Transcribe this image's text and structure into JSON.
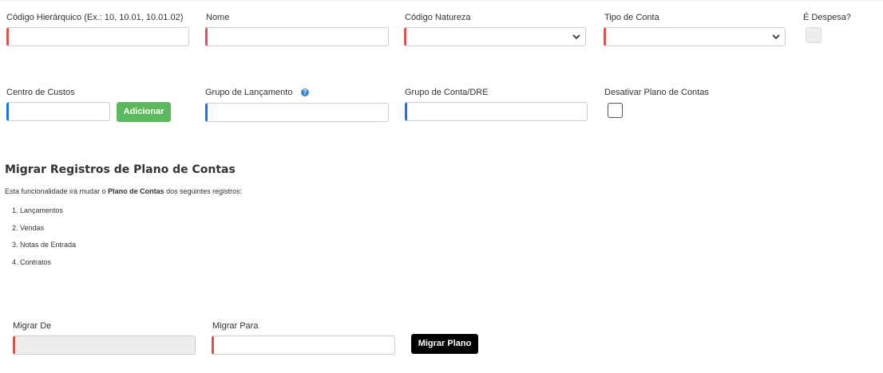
{
  "form": {
    "codigo_hierarquico": {
      "label": "Código Hierárquico (Ex.: 10, 10.01, 10.01.02)",
      "value": ""
    },
    "nome": {
      "label": "Nome",
      "value": ""
    },
    "codigo_natureza": {
      "label": "Código Natureza",
      "selected": ""
    },
    "tipo_conta": {
      "label": "Tipo de Conta",
      "selected": ""
    },
    "e_despesa": {
      "label": "É Despesa?",
      "checked": false,
      "disabled": true
    },
    "centro_custos": {
      "label": "Centro de Custos",
      "value": "",
      "add_button": "Adicionar"
    },
    "grupo_lancamento": {
      "label": "Grupo de Lançamento",
      "value": "",
      "help": "?"
    },
    "grupo_conta_dre": {
      "label": "Grupo de Conta/DRE",
      "value": ""
    },
    "desativar": {
      "label": "Desativar Plano de Contas",
      "checked": false
    }
  },
  "migrar": {
    "title": "Migrar Registros de Plano de Contas",
    "desc_prefix": "Esta funcionalidade irá mudar o ",
    "desc_bold": "Plano de Contas",
    "desc_suffix": " dos seguintes registros:",
    "items": [
      "1. Lançamentos",
      "2. Vendas",
      "3. Notas de Entrada",
      "4. Contratos"
    ],
    "de": {
      "label": "Migrar De",
      "value": ""
    },
    "para": {
      "label": "Migrar Para",
      "value": ""
    },
    "button": "Migrar Plano"
  },
  "colors": {
    "required": "#d9534f",
    "optional": "#1a73e8",
    "add_button": "#5cb85c",
    "migrate_button": "#000000"
  }
}
